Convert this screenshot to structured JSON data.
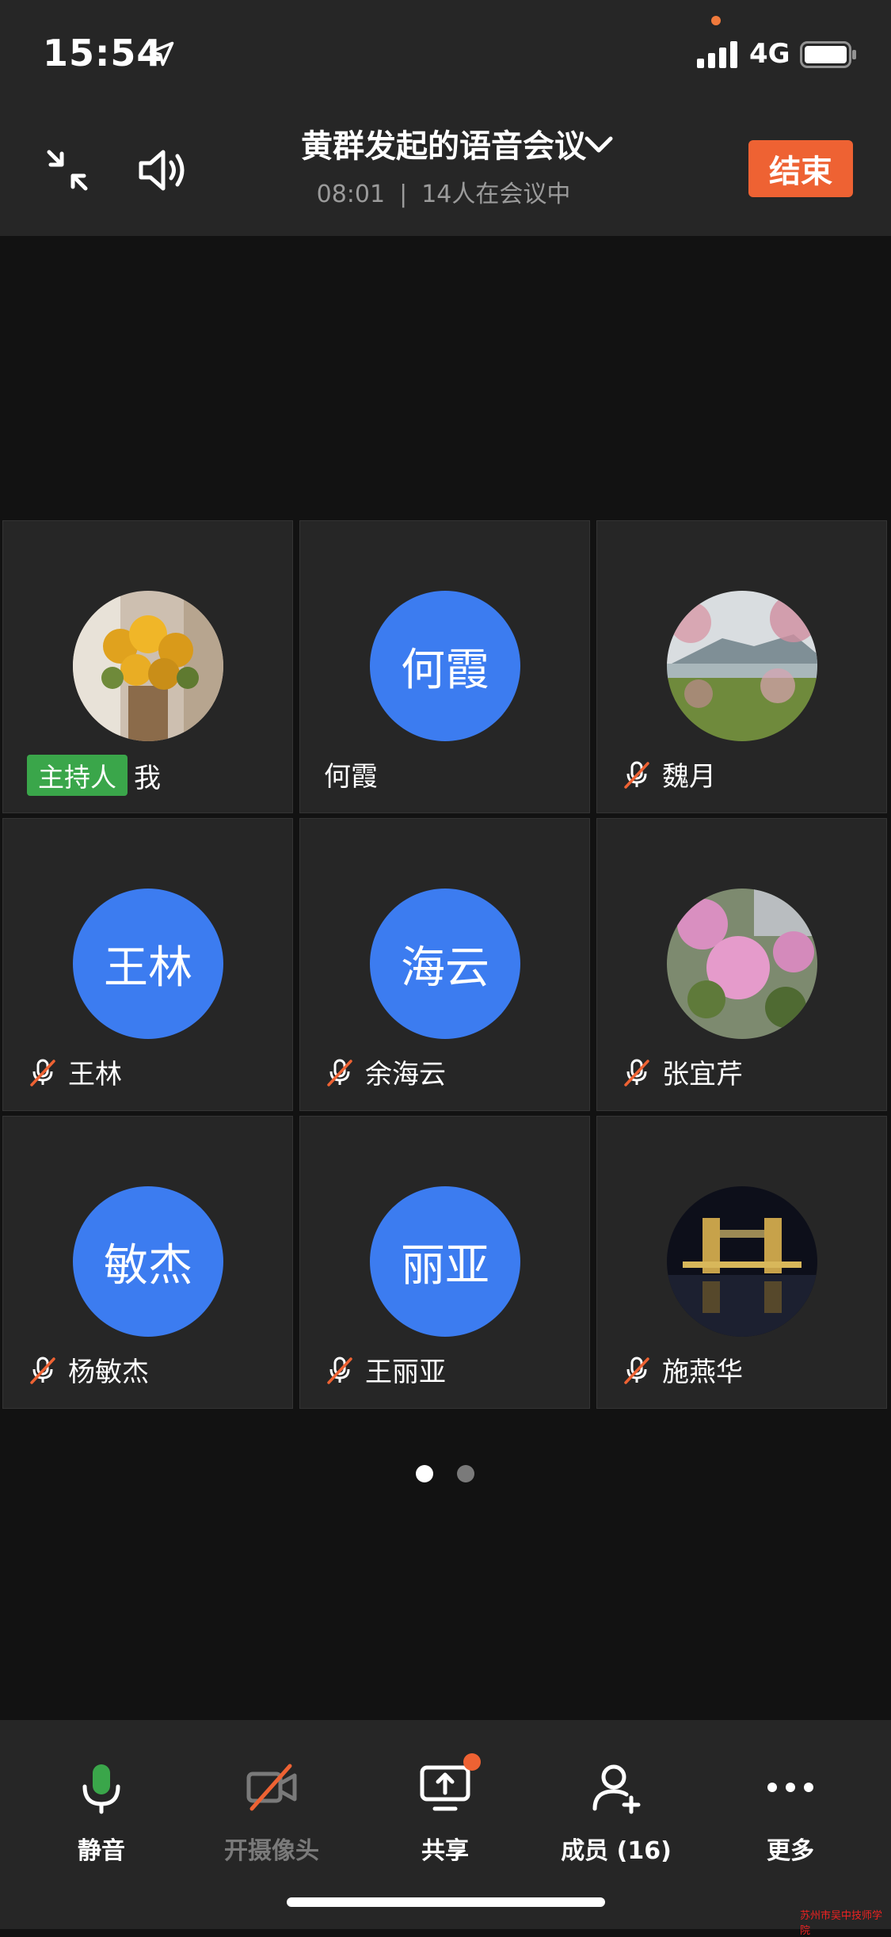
{
  "status_bar": {
    "time": "15:54",
    "network": "4G"
  },
  "header": {
    "title": "黄群发起的语音会议",
    "elapsed": "08:01",
    "separator": "|",
    "participants_text": "14人在会议中",
    "end_label": "结束"
  },
  "colors": {
    "accent": "#ee6233",
    "avatar_blue": "#3c7cf0",
    "host_green": "#3aa64a"
  },
  "tiles": [
    {
      "name": "我",
      "avatar_text": "",
      "avatar_image": "yellow-flowers",
      "host_label": "主持人",
      "muted": false
    },
    {
      "name": "何霞",
      "avatar_text": "何霞",
      "muted": false
    },
    {
      "name": "魏月",
      "avatar_text": "",
      "avatar_image": "peach-blossom-landscape",
      "muted": true
    },
    {
      "name": "王林",
      "avatar_text": "王林",
      "muted": true
    },
    {
      "name": "余海云",
      "avatar_text": "海云",
      "muted": true
    },
    {
      "name": "张宜芹",
      "avatar_text": "",
      "avatar_image": "pink-roses",
      "muted": true
    },
    {
      "name": "杨敏杰",
      "avatar_text": "敏杰",
      "muted": true
    },
    {
      "name": "王丽亚",
      "avatar_text": "丽亚",
      "muted": true
    },
    {
      "name": "施燕华",
      "avatar_text": "",
      "avatar_image": "tower-bridge-night",
      "muted": true
    }
  ],
  "pagination": {
    "current": 1,
    "total": 2
  },
  "toolbar": {
    "mute_label": "静音",
    "camera_label": "开摄像头",
    "share_label": "共享",
    "members_label": "成员 (16)",
    "more_label": "更多"
  },
  "watermark": "苏州市吴中技师学院"
}
